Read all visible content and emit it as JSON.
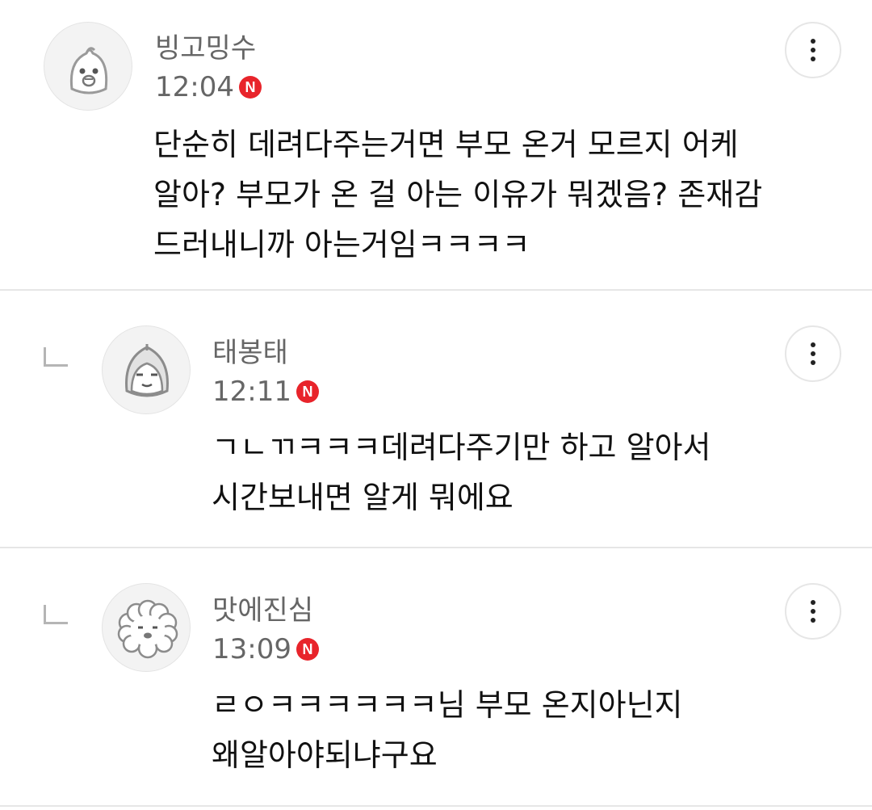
{
  "comments": [
    {
      "username": "빙고밍수",
      "time": "12:04",
      "badge": "N",
      "avatar_icon": "bingo-character-icon",
      "lines": [
        "단순히 데려다주는거면 부모 온거 모르지 어케",
        "알아? 부모가 온 걸 아는 이유가 뭐겠음? 존재감",
        "드러내니까 아는거임ㅋㅋㅋㅋ"
      ]
    },
    {
      "username": "태봉태",
      "time": "12:11",
      "badge": "N",
      "avatar_icon": "hooded-character-icon",
      "lines": [
        "ㄱㄴㄲㅋㅋㅋ데려다주기만 하고 알아서",
        "시간보내면 알게 뭐에요"
      ]
    },
    {
      "username": "맛에진심",
      "time": "13:09",
      "badge": "N",
      "avatar_icon": "poodle-character-icon",
      "lines": [
        "ㄹㅇㅋㅋㅋㅋㅋㅋ님 부모 온지아닌지",
        "왜알아야되냐구요"
      ]
    }
  ],
  "colors": {
    "badge": "#e8242b",
    "divider": "#e6e6e6",
    "meta_text": "#666666"
  }
}
